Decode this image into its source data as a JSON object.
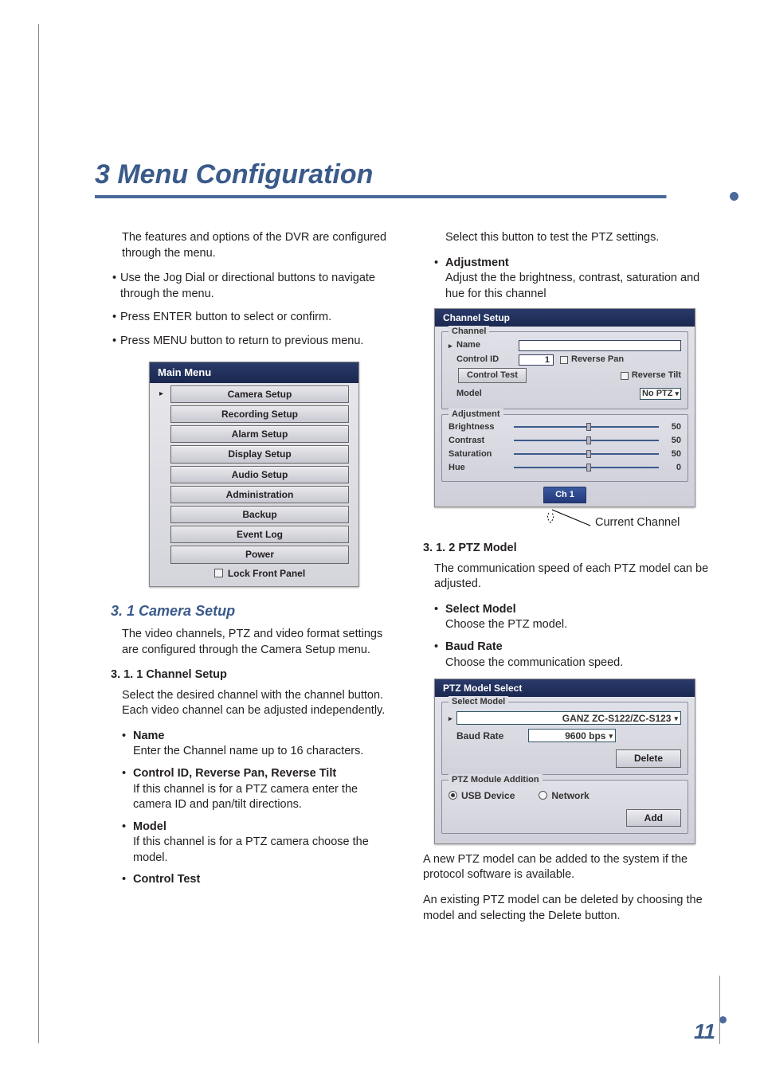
{
  "page_number": "11",
  "chapter_title": "3 Menu Configuration",
  "intro": "The features and options of the DVR are configured through the menu.",
  "intro_bullets": [
    "Use the Jog Dial or directional buttons to navigate through the menu.",
    "Press ENTER button to select or confirm.",
    "Press MENU button to return to previous menu."
  ],
  "main_menu": {
    "title": "Main Menu",
    "items": [
      "Camera Setup",
      "Recording Setup",
      "Alarm Setup",
      "Display Setup",
      "Audio Setup",
      "Administration",
      "Backup",
      "Event Log",
      "Power"
    ],
    "lock_label": "Lock Front Panel"
  },
  "h2_camera": "3. 1 Camera Setup",
  "camera_intro": "The video channels, PTZ and video format settings are configured through the Camera Setup menu.",
  "h3_channel": "3. 1. 1 Channel Setup",
  "channel_intro": "Select the desired channel with the channel button. Each video channel can be adjusted independently.",
  "channel_opts": [
    {
      "title": "Name",
      "desc": "Enter the Channel name up to 16 characters."
    },
    {
      "title": "Control ID, Reverse Pan, Reverse Tilt",
      "desc": "If this channel is for a PTZ camera enter the camera ID and pan/tilt directions."
    },
    {
      "title": "Model",
      "desc": "If this channel is for a PTZ camera choose the model."
    },
    {
      "title": "Control Test",
      "desc": ""
    }
  ],
  "control_test_desc": "Select this button to test the PTZ settings.",
  "adjustment_opt": {
    "title": "Adjustment",
    "desc": "Adjust the the brightness, contrast, saturation and hue for this channel"
  },
  "channel_setup": {
    "title": "Channel Setup",
    "group_channel": "Channel",
    "name_label": "Name",
    "control_id_label": "Control ID",
    "control_id_value": "1",
    "reverse_pan": "Reverse Pan",
    "reverse_tilt": "Reverse Tilt",
    "control_test": "Control Test",
    "model_label": "Model",
    "model_value": "No PTZ",
    "group_adjustment": "Adjustment",
    "sliders": [
      {
        "label": "Brightness",
        "value": "50",
        "pos": 50
      },
      {
        "label": "Contrast",
        "value": "50",
        "pos": 50
      },
      {
        "label": "Saturation",
        "value": "50",
        "pos": 50
      },
      {
        "label": "Hue",
        "value": "0",
        "pos": 50
      }
    ],
    "tab": "Ch 1"
  },
  "current_channel_annot": "Current Channel",
  "h3_ptz": "3. 1. 2 PTZ Model",
  "ptz_intro": "The communication speed of each PTZ model can be adjusted.",
  "ptz_opts": [
    {
      "title": "Select Model",
      "desc": "Choose the PTZ model."
    },
    {
      "title": "Baud Rate",
      "desc": "Choose the communication speed."
    }
  ],
  "ptz_select": {
    "title": "PTZ Model Select",
    "group_select": "Select Model",
    "model_value": "GANZ ZC-S122/ZC-S123",
    "baud_label": "Baud Rate",
    "baud_value": "9600 bps",
    "delete_btn": "Delete",
    "group_add": "PTZ Module Addition",
    "usb_label": "USB Device",
    "network_label": "Network",
    "add_btn": "Add"
  },
  "ptz_para1": "A new PTZ model can be added to the system if the protocol software is available.",
  "ptz_para2": "An existing PTZ model can be deleted by choosing the model and selecting the Delete button."
}
